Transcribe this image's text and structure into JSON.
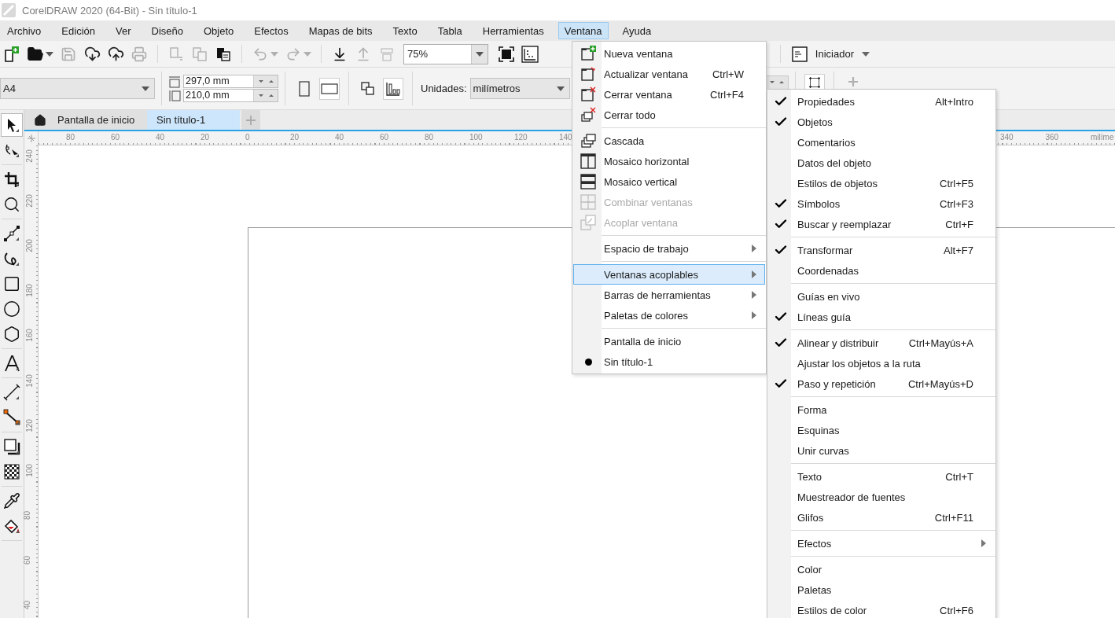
{
  "window": {
    "title": "CorelDRAW 2020 (64-Bit) - Sin título-1"
  },
  "menubar": [
    {
      "label": "Archivo",
      "selected": false
    },
    {
      "label": "Edición",
      "selected": false
    },
    {
      "label": "Ver",
      "selected": false
    },
    {
      "label": "Diseño",
      "selected": false
    },
    {
      "label": "Objeto",
      "selected": false
    },
    {
      "label": "Efectos",
      "selected": false
    },
    {
      "label": "Mapas de bits",
      "selected": false
    },
    {
      "label": "Texto",
      "selected": false
    },
    {
      "label": "Tabla",
      "selected": false
    },
    {
      "label": "Herramientas",
      "selected": false
    },
    {
      "label": "Ventana",
      "selected": true
    },
    {
      "label": "Ayuda",
      "selected": false
    }
  ],
  "toolbar": {
    "zoom": "75%",
    "launcher": "Iniciador"
  },
  "property_bar": {
    "page_size": "A4",
    "width": "297,0 mm",
    "height": "210,0 mm",
    "units_label": "Unidades:",
    "units": "milímetros"
  },
  "tabs": [
    {
      "label": "Pantalla de inicio",
      "selected": false
    },
    {
      "label": "Sin título-1",
      "selected": true
    }
  ],
  "toolbox": [
    {
      "selected": true
    },
    {
      "selected": false
    },
    {
      "selected": false
    },
    {
      "selected": false
    },
    {
      "selected": false
    },
    {
      "selected": false
    },
    {
      "selected": false
    },
    {
      "selected": false
    },
    {
      "selected": false
    },
    {
      "selected": false
    },
    {
      "selected": false
    },
    {
      "selected": false
    },
    {
      "selected": false
    },
    {
      "selected": false
    },
    {
      "selected": false
    },
    {
      "selected": false
    }
  ],
  "rulers": {
    "horizontal": [
      "80",
      "60",
      "40",
      "20",
      "0",
      "20",
      "40",
      "60",
      "80",
      "100",
      "120",
      "140",
      "340",
      "360",
      "milíme"
    ],
    "vertical": [
      "240",
      "220",
      "200",
      "180",
      "160",
      "140",
      "120",
      "100",
      "80",
      "60",
      "40"
    ]
  },
  "window_menu": {
    "sections": [
      {
        "items": [
          {
            "label": "Nueva ventana",
            "disabled": false,
            "selected": false,
            "submenu": false,
            "checked": false
          },
          {
            "label": "Actualizar ventana",
            "shortcut": "Ctrl+W",
            "disabled": false,
            "selected": false,
            "submenu": false,
            "checked": false
          },
          {
            "label": "Cerrar ventana",
            "shortcut": "Ctrl+F4",
            "disabled": false,
            "selected": false,
            "submenu": false,
            "checked": false
          },
          {
            "label": "Cerrar todo",
            "disabled": false,
            "selected": false,
            "submenu": false,
            "checked": false
          }
        ]
      },
      {
        "items": [
          {
            "label": "Cascada",
            "disabled": false,
            "selected": false,
            "submenu": false,
            "checked": false
          },
          {
            "label": "Mosaico horizontal",
            "disabled": false,
            "selected": false,
            "submenu": false,
            "checked": false
          },
          {
            "label": "Mosaico vertical",
            "disabled": false,
            "selected": false,
            "submenu": false,
            "checked": false
          },
          {
            "label": "Combinar ventanas",
            "disabled": true,
            "selected": false,
            "submenu": false,
            "checked": false
          },
          {
            "label": "Acoplar ventana",
            "disabled": true,
            "selected": false,
            "submenu": false,
            "checked": false
          }
        ]
      },
      {
        "items": [
          {
            "label": "Espacio de trabajo",
            "disabled": false,
            "selected": false,
            "submenu": true,
            "checked": false
          }
        ]
      },
      {
        "items": [
          {
            "label": "Ventanas acoplables",
            "disabled": false,
            "selected": true,
            "submenu": true,
            "checked": false
          },
          {
            "label": "Barras de herramientas",
            "disabled": false,
            "selected": false,
            "submenu": true,
            "checked": false
          },
          {
            "label": "Paletas de colores",
            "disabled": false,
            "selected": false,
            "submenu": true,
            "checked": false
          }
        ]
      },
      {
        "items": [
          {
            "label": "Pantalla de inicio",
            "disabled": false,
            "selected": false,
            "submenu": false,
            "checked": false
          },
          {
            "label": "Sin título-1",
            "disabled": false,
            "selected": false,
            "submenu": false,
            "checked": true
          }
        ]
      }
    ]
  },
  "dockers_menu": {
    "sections": [
      {
        "items": [
          {
            "label": "Propiedades",
            "shortcut": "Alt+Intro",
            "checked": true,
            "submenu": false
          },
          {
            "label": "Objetos",
            "checked": true,
            "submenu": false
          },
          {
            "label": "Comentarios",
            "checked": false,
            "submenu": false
          },
          {
            "label": "Datos del objeto",
            "checked": false,
            "submenu": false
          },
          {
            "label": "Estilos de objetos",
            "shortcut": "Ctrl+F5",
            "checked": false,
            "submenu": false
          },
          {
            "label": "Símbolos",
            "shortcut": "Ctrl+F3",
            "checked": true,
            "submenu": false
          },
          {
            "label": "Buscar y reemplazar",
            "shortcut": "Ctrl+F",
            "checked": true,
            "submenu": false
          }
        ]
      },
      {
        "items": [
          {
            "label": "Transformar",
            "shortcut": "Alt+F7",
            "checked": true,
            "submenu": false
          },
          {
            "label": "Coordenadas",
            "checked": false,
            "submenu": false
          }
        ]
      },
      {
        "items": [
          {
            "label": "Guías en vivo",
            "checked": false,
            "submenu": false
          },
          {
            "label": "Líneas guía",
            "checked": true,
            "submenu": false
          }
        ]
      },
      {
        "items": [
          {
            "label": "Alinear y distribuir",
            "shortcut": "Ctrl+Mayús+A",
            "checked": true,
            "submenu": false
          },
          {
            "label": "Ajustar los objetos a la ruta",
            "checked": false,
            "submenu": false
          },
          {
            "label": "Paso y repetición",
            "shortcut": "Ctrl+Mayús+D",
            "checked": true,
            "submenu": false
          }
        ]
      },
      {
        "items": [
          {
            "label": "Forma",
            "checked": false,
            "submenu": false
          },
          {
            "label": "Esquinas",
            "checked": false,
            "submenu": false
          },
          {
            "label": "Unir curvas",
            "checked": false,
            "submenu": false
          }
        ]
      },
      {
        "items": [
          {
            "label": "Texto",
            "shortcut": "Ctrl+T",
            "checked": false,
            "submenu": false
          },
          {
            "label": "Muestreador de fuentes",
            "checked": false,
            "submenu": false
          },
          {
            "label": "Glifos",
            "shortcut": "Ctrl+F11",
            "checked": false,
            "submenu": false
          }
        ]
      },
      {
        "items": [
          {
            "label": "Efectos",
            "checked": false,
            "submenu": true
          }
        ]
      },
      {
        "items": [
          {
            "label": "Color",
            "checked": false,
            "submenu": false
          },
          {
            "label": "Paletas",
            "checked": false,
            "submenu": false
          },
          {
            "label": "Estilos de color",
            "shortcut": "Ctrl+F6",
            "checked": false,
            "submenu": false
          }
        ]
      }
    ]
  }
}
